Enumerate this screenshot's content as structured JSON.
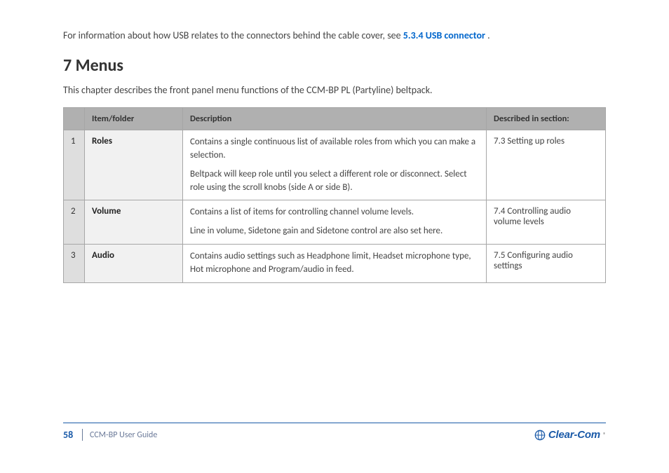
{
  "intro_text_before": "For information about how USB relates to the connectors behind the cable cover, see\n",
  "intro_link": "5.3.4 USB connector",
  "intro_text_after": ".",
  "heading": "7 Menus",
  "subtitle": "This chapter describes the front panel menu functions of the CCM-BP PL (Partyline) beltpack.",
  "table": {
    "headers": [
      "",
      "Item/folder",
      "Description",
      "Described in section:"
    ],
    "rows": [
      {
        "num": "1",
        "folder": "Roles",
        "desc_lines": [
          "Contains a single continuous list of available roles from which you can make a selection.",
          "Beltpack will keep role until you select a different role or disconnect. Select role using the scroll knobs (side A or side B)."
        ],
        "section": "7.3 Setting up\nroles"
      },
      {
        "num": "2",
        "folder": "Volume",
        "desc_lines": [
          "Contains a list of items for controlling channel volume levels.",
          "Line in volume, Sidetone gain and Sidetone control are also set here."
        ],
        "section": "7.4 Controlling\naudio volume\nlevels"
      },
      {
        "num": "3",
        "folder": "Audio",
        "desc_lines": [
          "Contains audio settings such as Headphone limit, Headset microphone type, Hot microphone and Program/audio in feed."
        ],
        "section": "7.5 Configuring\naudio settings"
      }
    ]
  },
  "footer": {
    "page": "58",
    "text": "CCM-BP User Guide",
    "brand": "Clear-Com"
  }
}
